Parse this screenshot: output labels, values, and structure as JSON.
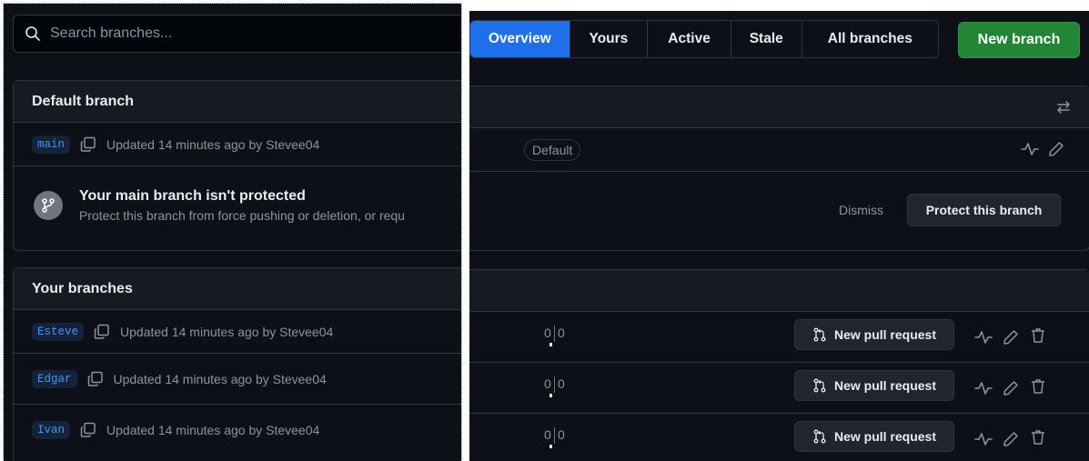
{
  "search": {
    "placeholder": "Search branches..."
  },
  "tabs": [
    {
      "label": "Overview",
      "active": true
    },
    {
      "label": "Yours",
      "active": false
    },
    {
      "label": "Active",
      "active": false
    },
    {
      "label": "Stale",
      "active": false
    },
    {
      "label": "All branches",
      "active": false
    }
  ],
  "new_branch_label": "New branch",
  "default_section": {
    "title": "Default branch",
    "branch": {
      "name": "main",
      "updated": "Updated 14 minutes ago by Stevee04",
      "badge": "Default"
    },
    "notice": {
      "title": "Your main branch isn't protected",
      "description": "Protect this branch from force pushing or deletion, or requ",
      "dismiss_label": "Dismiss",
      "protect_label": "Protect this branch"
    }
  },
  "your_section": {
    "title": "Your branches",
    "branches": [
      {
        "name": "Esteve",
        "updated": "Updated 14 minutes ago by Stevee04",
        "behind": "0",
        "ahead": "0",
        "pr_label": "New pull request"
      },
      {
        "name": "Edgar",
        "updated": "Updated 14 minutes ago by Stevee04",
        "behind": "0",
        "ahead": "0",
        "pr_label": "New pull request"
      },
      {
        "name": "Ivan",
        "updated": "Updated 14 minutes ago by Stevee04",
        "behind": "0",
        "ahead": "0",
        "pr_label": "New pull request"
      }
    ]
  },
  "colors": {
    "background": "#0d1117",
    "accent": "#1f6feb",
    "primary_button": "#238636",
    "link": "#4493f8"
  }
}
